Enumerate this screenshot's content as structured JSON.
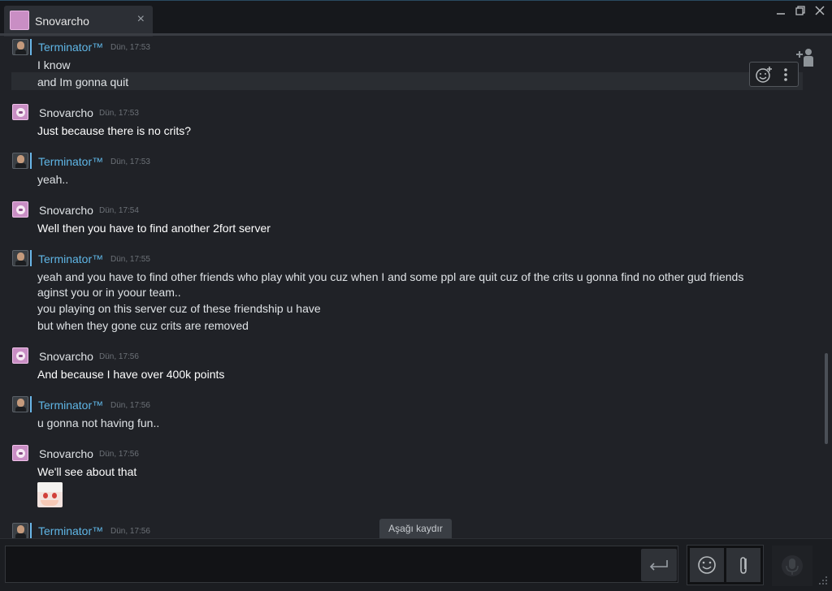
{
  "window": {
    "tab_title": "Snovarcho",
    "tab_close": "×",
    "minimize": "_",
    "restore": "❐",
    "close": "✕"
  },
  "messages": [
    {
      "author": "Terminator™",
      "time": "Dün, 17:53",
      "lines": [
        "I know",
        "and Im gonna quit"
      ]
    },
    {
      "author": "Snovarcho",
      "time": "Dün, 17:53",
      "lines": [
        "Just because there is no crits?"
      ]
    },
    {
      "author": "Terminator™",
      "time": "Dün, 17:53",
      "lines": [
        "yeah.."
      ]
    },
    {
      "author": "Snovarcho",
      "time": "Dün, 17:54",
      "lines": [
        "Well then you have to find another 2fort server"
      ]
    },
    {
      "author": "Terminator™",
      "time": "Dün, 17:55",
      "lines": [
        "yeah and you have to find other friends who play whit you cuz when I and some ppl are quit cuz of the crits u gonna find no other gud friends",
        "aginst you or in yoour team..",
        "you playing on this server cuz of these friendship u have",
        "but when they gone cuz crits are removed"
      ]
    },
    {
      "author": "Snovarcho",
      "time": "Dün, 17:56",
      "lines": [
        "And because I have over 400k points"
      ]
    },
    {
      "author": "Terminator™",
      "time": "Dün, 17:56",
      "lines": [
        "u gonna not having fun.."
      ]
    },
    {
      "author": "Snovarcho",
      "time": "Dün, 17:56",
      "lines": [
        "We'll see about that"
      ]
    },
    {
      "author": "Terminator™",
      "time": "Dün, 17:56",
      "lines": []
    }
  ],
  "scroll_down_label": "Aşağı kaydır",
  "icons": {
    "emoji_reaction": "add-emoji-icon",
    "more": "more-vertical-icon",
    "invite": "invite-friend-icon",
    "send": "enter-icon",
    "emoji": "smiley-icon",
    "attach": "paperclip-icon",
    "voice": "microphone-icon"
  },
  "colors": {
    "background": "#202227",
    "friend_name": "#5fb6e6",
    "text": "#dfe3e6",
    "timestamp": "#6c7177"
  }
}
